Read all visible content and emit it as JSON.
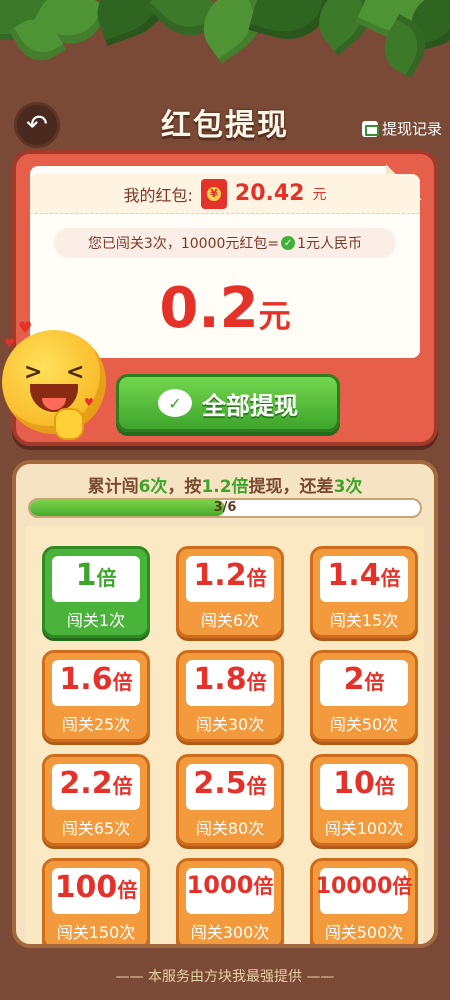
{
  "header": {
    "title": "红包提现",
    "record_label": "提现记录"
  },
  "card": {
    "hongbao_label": "我的红包:",
    "hongbao_amount": "20.42",
    "hongbao_unit": "元",
    "passed_text_1": "您已闯关3次，10000元红包=",
    "passed_text_2": "1元人民币",
    "amount": "0.2",
    "amount_unit": "元",
    "withdraw_label": "全部提现"
  },
  "progress": {
    "text_a": "累计闯",
    "count": "6次",
    "text_b": "，按",
    "multiplier": "1.2倍",
    "text_c": "提现，还差",
    "remaining": "3次",
    "label": "3/6",
    "fraction": 0.5
  },
  "tiers": [
    {
      "mult": "1",
      "unit": "倍",
      "req": "闯关1次",
      "active": true
    },
    {
      "mult": "1.2",
      "unit": "倍",
      "req": "闯关6次"
    },
    {
      "mult": "1.4",
      "unit": "倍",
      "req": "闯关15次"
    },
    {
      "mult": "1.6",
      "unit": "倍",
      "req": "闯关25次"
    },
    {
      "mult": "1.8",
      "unit": "倍",
      "req": "闯关30次"
    },
    {
      "mult": "2",
      "unit": "倍",
      "req": "闯关50次"
    },
    {
      "mult": "2.2",
      "unit": "倍",
      "req": "闯关65次"
    },
    {
      "mult": "2.5",
      "unit": "倍",
      "req": "闯关80次"
    },
    {
      "mult": "10",
      "unit": "倍",
      "req": "闯关100次"
    },
    {
      "mult": "100",
      "unit": "倍",
      "req": "闯关150次"
    },
    {
      "mult": "1000",
      "unit": "倍",
      "req": "闯关300次"
    },
    {
      "mult": "10000",
      "unit": "倍",
      "req": "闯关500次"
    }
  ],
  "footer": "—— 本服务由方块我最强提供 ——",
  "colors": {
    "accent_red": "#e4322a",
    "accent_green": "#3ea52c",
    "tier_orange": "#f29a3c"
  }
}
